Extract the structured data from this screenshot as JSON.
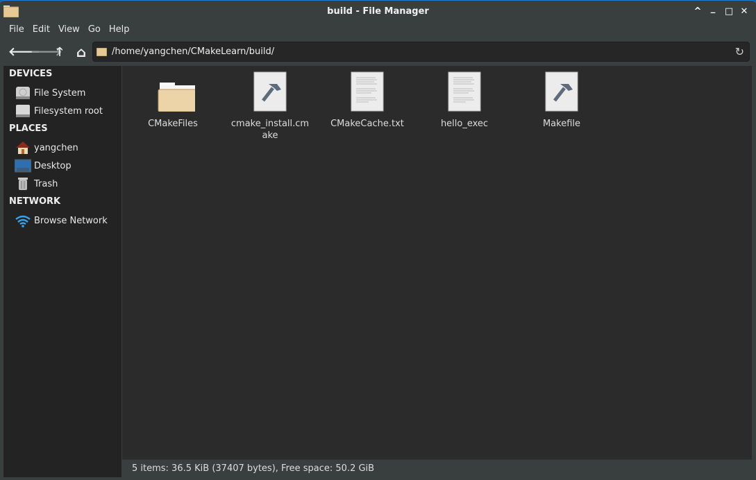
{
  "window": {
    "title": "build - File Manager",
    "controls": {
      "shade": "^",
      "minimize": "_",
      "maximize": "□",
      "close": "✕"
    }
  },
  "menu": [
    "File",
    "Edit",
    "View",
    "Go",
    "Help"
  ],
  "toolbar": {
    "back": "🡐",
    "forward": "🡒",
    "up": "🡑",
    "home": "⌂",
    "path": "/home/yangchen/CMakeLearn/build/",
    "reload": "↻"
  },
  "sidebar": {
    "devices": {
      "title": "DEVICES",
      "items": [
        {
          "label": "File System",
          "icon": "drive-harddisk-icon"
        },
        {
          "label": "Filesystem root",
          "icon": "drive-icon"
        }
      ]
    },
    "places": {
      "title": "PLACES",
      "items": [
        {
          "label": "yangchen",
          "icon": "home-icon"
        },
        {
          "label": "Desktop",
          "icon": "desktop-icon"
        },
        {
          "label": "Trash",
          "icon": "trash-icon"
        }
      ]
    },
    "network": {
      "title": "NETWORK",
      "items": [
        {
          "label": "Browse Network",
          "icon": "wifi-icon"
        }
      ]
    }
  },
  "files": [
    {
      "name": "CMakeFiles",
      "type": "folder"
    },
    {
      "name": "cmake_install.cmake",
      "type": "build"
    },
    {
      "name": "CMakeCache.txt",
      "type": "text"
    },
    {
      "name": "hello_exec",
      "type": "text"
    },
    {
      "name": "Makefile",
      "type": "build"
    }
  ],
  "status": "5 items: 36.5 KiB (37407 bytes), Free space: 50.2 GiB"
}
